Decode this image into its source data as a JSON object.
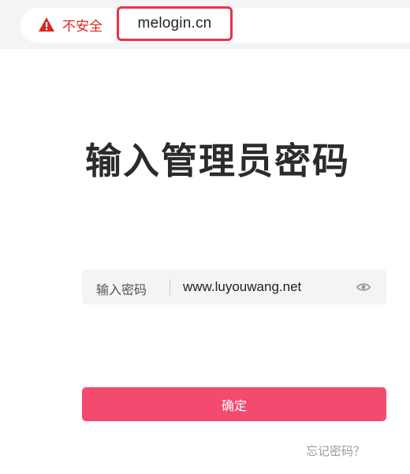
{
  "browser": {
    "security_label": "不安全",
    "url": "melogin.cn",
    "warning_icon": "warning-triangle-icon",
    "security_color": "#d9281e",
    "highlight_color": "#e8324a"
  },
  "login": {
    "title": "输入管理员密码",
    "password_label": "输入密码",
    "password_value": "www.luyouwang.net",
    "reveal_icon": "eye-icon",
    "confirm_label": "确定",
    "forgot_label": "忘记密码？",
    "accent_color": "#f24b6f"
  }
}
